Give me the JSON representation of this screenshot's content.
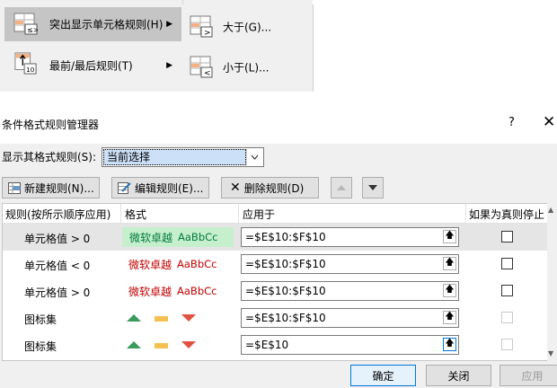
{
  "menu": {
    "left_items": [
      {
        "label": "突出显示单元格规则(H)"
      },
      {
        "label": "最前/最后规则(T)"
      }
    ],
    "right_items": [
      {
        "label": "大于(G)..."
      },
      {
        "label": "小于(L)..."
      }
    ]
  },
  "dialog": {
    "title": "条件格式规则管理器",
    "help": "?",
    "close": "✕",
    "show_label": "显示其格式规则(S):",
    "show_value": "当前选择",
    "buttons": {
      "new": "新建规则(N)...",
      "edit": "编辑规则(E)...",
      "delete": "删除规则(D)"
    },
    "columns": [
      "规则(按所示顺序应用)",
      "格式",
      "应用于",
      "如果为真则停止"
    ],
    "rules": [
      {
        "name": "单元格值 > 0",
        "preview": "微软卓越",
        "sample": "AaBbCc",
        "applies_to": "=$E$10:$F$10"
      },
      {
        "name": "单元格值 < 0",
        "preview": "微软卓越",
        "sample": "AaBbCc",
        "applies_to": "=$E$10:$F$10"
      },
      {
        "name": "单元格值 > 0",
        "preview": "微软卓越",
        "sample": "AaBbCc",
        "applies_to": "=$E$10:$F$10"
      },
      {
        "name": "图标集",
        "applies_to": "=$E$10:$F$10"
      },
      {
        "name": "图标集",
        "applies_to": "=$E$10"
      }
    ],
    "footer": {
      "ok": "确定",
      "close": "关闭",
      "apply": "应用"
    },
    "colors": {
      "accent": "#0078d7",
      "green_fill": "#c6efce",
      "green_text": "#007a3d",
      "red_text": "#c00000"
    }
  }
}
